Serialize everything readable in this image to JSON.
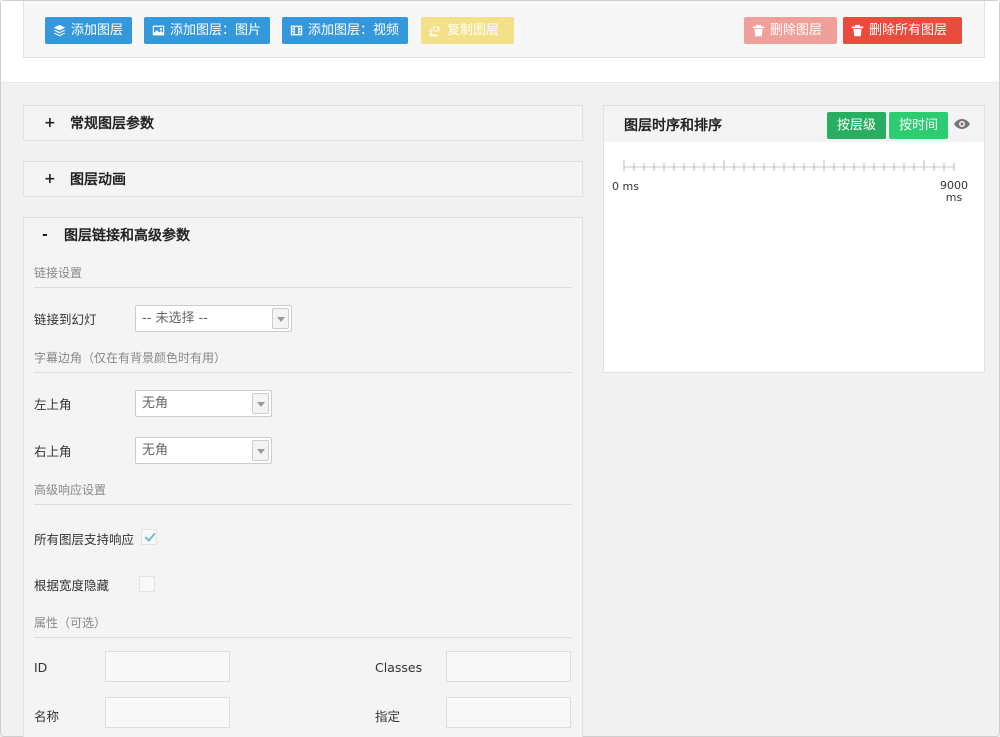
{
  "toolbar": {
    "add_layer": "添加图层",
    "add_layer_image": "添加图层：图片",
    "add_layer_video": "添加图层：视频",
    "copy_layer": "复制图层",
    "delete_layer": "删除图层",
    "delete_all_layers": "删除所有图层"
  },
  "panels": {
    "general": {
      "sign": "+",
      "title": "常规图层参数"
    },
    "animation": {
      "sign": "+",
      "title": "图层动画"
    },
    "advanced": {
      "sign": "-",
      "title": "图层链接和高级参数"
    }
  },
  "advanced": {
    "link_section": "链接设置",
    "link_to_slide_label": "链接到幻灯",
    "link_to_slide_value": "-- 未选择 --",
    "corner_section": "字幕边角（仅在有背景颜色时有用）",
    "top_left_label": "左上角",
    "top_left_value": "无角",
    "top_right_label": "右上角",
    "top_right_value": "无角",
    "responsive_section": "高级响应设置",
    "responsive_all_label": "所有图层支持响应",
    "responsive_all_checked": true,
    "hide_by_width_label": "根据宽度隐藏",
    "hide_by_width_checked": false,
    "attributes_section": "属性（可选）",
    "id_label": "ID",
    "classes_label": "Classes",
    "name_label": "名称",
    "assign_label": "指定"
  },
  "timeline": {
    "title": "图层时序和排序",
    "by_depth": "按层级",
    "by_time": "按时间",
    "start_label": "0 ms",
    "end_label_value": "9000",
    "end_label_unit": "ms"
  },
  "colors": {
    "blue": "#3498db",
    "yellow": "#f5e08a",
    "pink": "#f0a09a",
    "red": "#e74c3c",
    "green_dark": "#27ae60",
    "green_light": "#2ecc71"
  }
}
